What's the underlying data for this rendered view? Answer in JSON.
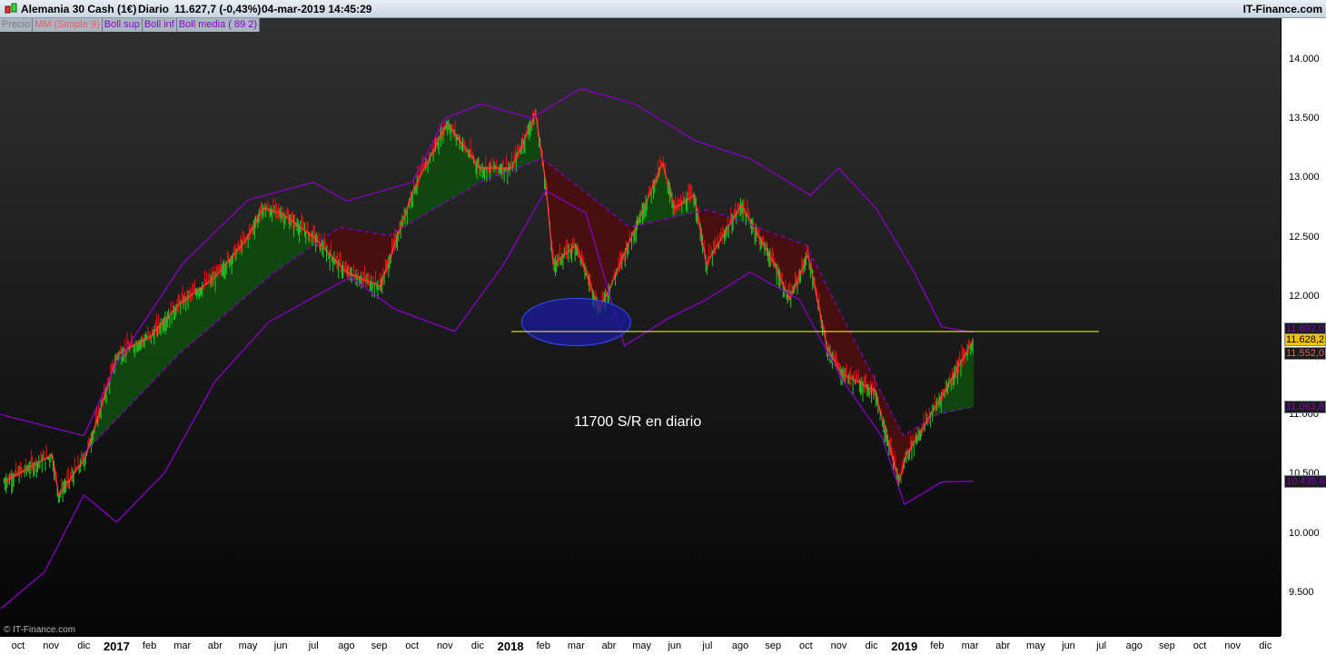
{
  "header": {
    "instrument": "Alemania 30 Cash (1€)",
    "period": "Diario",
    "price": "11.627,7 (-0,43%)",
    "datetime": "04-mar-2019 14:45:29",
    "brand": "IT-Finance.com",
    "logo_icon": "candlestick-icon"
  },
  "legend": [
    {
      "label": "Precio",
      "color": "#7d7d7d"
    },
    {
      "label": "MM (Simple 9)",
      "color": "#e86060"
    },
    {
      "label": "Boll sup",
      "color": "#8a00c8"
    },
    {
      "label": "Boll inf",
      "color": "#8a00c8"
    },
    {
      "label": "Boll media ( 89 2)",
      "color": "#8a00c8"
    }
  ],
  "watermark": "© IT-Finance.com",
  "annotation": "11700 S/R en diario",
  "colors": {
    "bull": "#22cc22",
    "bear": "#ee1111",
    "band": "#8a00c8",
    "ma": "#ff4040",
    "fill_up": "#0e4a0e",
    "fill_down": "#4a0e0e",
    "sr_line": "#e8e830",
    "ellipse": "#1a1aa0"
  },
  "chart_data": {
    "type": "line",
    "ylim": [
      9000,
      14500
    ],
    "y_ticks": [
      "14.000",
      "13.500",
      "13.000",
      "12.500",
      "12.000",
      "11.500",
      "11.000",
      "10.500",
      "10.000",
      "9.500"
    ],
    "y_tick_values": [
      14000,
      13500,
      13000,
      12500,
      12000,
      11500,
      11000,
      10500,
      10000,
      9500
    ],
    "x_ticks": [
      "oct",
      "nov",
      "dic",
      "2017",
      "feb",
      "mar",
      "abr",
      "may",
      "jun",
      "jul",
      "ago",
      "sep",
      "oct",
      "nov",
      "dic",
      "2018",
      "feb",
      "mar",
      "abr",
      "may",
      "jun",
      "jul",
      "ago",
      "sep",
      "oct",
      "nov",
      "dic",
      "2019",
      "feb",
      "mar",
      "abr",
      "may",
      "jun",
      "jul",
      "ago",
      "sep",
      "oct",
      "nov",
      "dic"
    ],
    "support_resistance": 11700,
    "ellipse_center": {
      "date": "2018-03-01",
      "value": 11780
    },
    "last_values": [
      {
        "label": "11.692,0",
        "color": "#8a00c8"
      },
      {
        "label": "11.628,2",
        "color": "#000",
        "bg": "#f5c000"
      },
      {
        "label": "11.552,0",
        "color": "#e86060"
      },
      {
        "label": "11.063,8",
        "color": "#8a00c8"
      },
      {
        "label": "10.435,6",
        "color": "#8a00c8"
      }
    ],
    "last_value_levels": [
      11692,
      11628.2,
      11552,
      11063.8,
      10435.6
    ],
    "series": [
      {
        "name": "Precio",
        "points": [
          [
            "2016-09-18",
            10430
          ],
          [
            "2016-11-02",
            10660
          ],
          [
            "2016-11-08",
            10320
          ],
          [
            "2016-12-02",
            10630
          ],
          [
            "2017-01-02",
            11510
          ],
          [
            "2017-02-02",
            11660
          ],
          [
            "2017-02-28",
            11930
          ],
          [
            "2017-04-01",
            12160
          ],
          [
            "2017-04-29",
            12470
          ],
          [
            "2017-05-15",
            12740
          ],
          [
            "2017-06-01",
            12700
          ],
          [
            "2017-07-01",
            12500
          ],
          [
            "2017-08-01",
            12200
          ],
          [
            "2017-09-02",
            12080
          ],
          [
            "2017-10-02",
            12890
          ],
          [
            "2017-11-03",
            13460
          ],
          [
            "2017-12-03",
            13080
          ],
          [
            "2018-01-02",
            13080
          ],
          [
            "2018-01-24",
            13540
          ],
          [
            "2018-02-03",
            12970
          ],
          [
            "2018-02-10",
            12270
          ],
          [
            "2018-03-01",
            12430
          ],
          [
            "2018-03-22",
            11890
          ],
          [
            "2018-04-01",
            12050
          ],
          [
            "2018-04-29",
            12660
          ],
          [
            "2018-05-20",
            13120
          ],
          [
            "2018-06-01",
            12740
          ],
          [
            "2018-06-19",
            12850
          ],
          [
            "2018-06-30",
            12270
          ],
          [
            "2018-08-02",
            12770
          ],
          [
            "2018-09-02",
            12270
          ],
          [
            "2018-09-16",
            11970
          ],
          [
            "2018-10-03",
            12350
          ],
          [
            "2018-10-20",
            11580
          ],
          [
            "2018-11-03",
            11350
          ],
          [
            "2018-12-04",
            11200
          ],
          [
            "2018-12-26",
            10430
          ],
          [
            "2019-01-03",
            10660
          ],
          [
            "2019-02-03",
            11120
          ],
          [
            "2019-03-04",
            11628
          ]
        ]
      },
      {
        "name": "Boll sup",
        "points": [
          [
            "2016-09-15",
            11000
          ],
          [
            "2016-12-01",
            10820
          ],
          [
            "2017-01-01",
            11430
          ],
          [
            "2017-03-01",
            12270
          ],
          [
            "2017-05-01",
            12810
          ],
          [
            "2017-07-01",
            12960
          ],
          [
            "2017-08-01",
            12800
          ],
          [
            "2017-10-01",
            12960
          ],
          [
            "2017-11-01",
            13500
          ],
          [
            "2017-12-05",
            13620
          ],
          [
            "2018-01-20",
            13500
          ],
          [
            "2018-03-05",
            13750
          ],
          [
            "2018-04-25",
            13620
          ],
          [
            "2018-06-20",
            13310
          ],
          [
            "2018-08-10",
            13160
          ],
          [
            "2018-10-05",
            12850
          ],
          [
            "2018-11-01",
            13080
          ],
          [
            "2018-12-05",
            12740
          ],
          [
            "2019-01-10",
            12200
          ],
          [
            "2019-02-05",
            11740
          ],
          [
            "2019-03-04",
            11692
          ]
        ]
      },
      {
        "name": "Boll inf",
        "points": [
          [
            "2016-09-15",
            9360
          ],
          [
            "2016-10-25",
            9670
          ],
          [
            "2016-12-01",
            10320
          ],
          [
            "2017-01-01",
            10090
          ],
          [
            "2017-02-15",
            10510
          ],
          [
            "2017-04-01",
            11280
          ],
          [
            "2017-05-20",
            11780
          ],
          [
            "2017-07-05",
            12010
          ],
          [
            "2017-08-05",
            12160
          ],
          [
            "2017-09-15",
            11890
          ],
          [
            "2017-11-10",
            11700
          ],
          [
            "2017-12-25",
            12270
          ],
          [
            "2018-02-03",
            12890
          ],
          [
            "2018-03-10",
            12700
          ],
          [
            "2018-04-15",
            11580
          ],
          [
            "2018-05-25",
            11810
          ],
          [
            "2018-06-30",
            11970
          ],
          [
            "2018-08-10",
            12200
          ],
          [
            "2018-09-25",
            11970
          ],
          [
            "2018-11-05",
            11280
          ],
          [
            "2018-12-10",
            10820
          ],
          [
            "2019-01-01",
            10240
          ],
          [
            "2019-02-05",
            10430
          ],
          [
            "2019-03-04",
            10436
          ]
        ]
      },
      {
        "name": "Boll media",
        "points": [
          [
            "2016-12-01",
            10670
          ],
          [
            "2017-02-28",
            11510
          ],
          [
            "2017-05-25",
            12200
          ],
          [
            "2017-07-25",
            12580
          ],
          [
            "2017-09-10",
            12510
          ],
          [
            "2017-12-05",
            12970
          ],
          [
            "2018-01-30",
            13160
          ],
          [
            "2018-04-20",
            12580
          ],
          [
            "2018-07-01",
            12730
          ],
          [
            "2018-10-01",
            12430
          ],
          [
            "2018-12-30",
            10820
          ],
          [
            "2019-02-01",
            11000
          ],
          [
            "2019-03-04",
            11064
          ]
        ]
      }
    ]
  }
}
